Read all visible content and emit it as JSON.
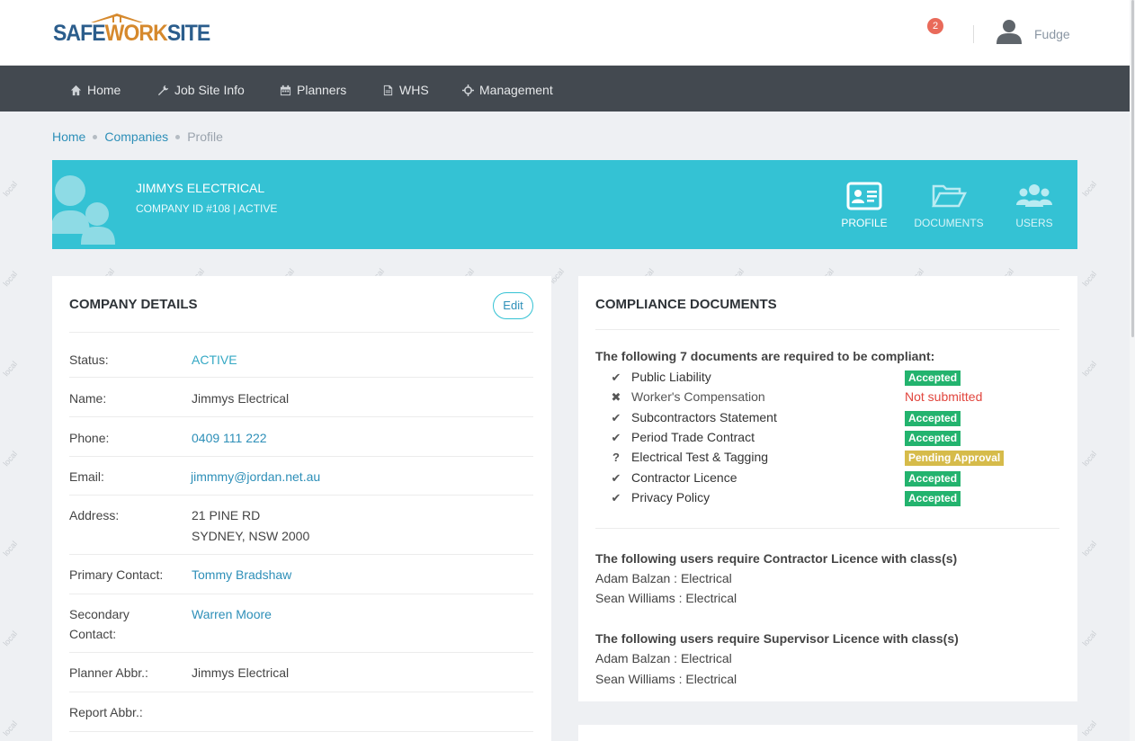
{
  "header": {
    "logo": {
      "safe": "SAFE",
      "work": "WORK",
      "site": "SITE"
    },
    "notification_count": "2",
    "user_name": "Fudge"
  },
  "nav": {
    "items": [
      {
        "label": "Home",
        "icon": "home-icon"
      },
      {
        "label": "Job Site Info",
        "icon": "wrench-icon"
      },
      {
        "label": "Planners",
        "icon": "calendar-icon"
      },
      {
        "label": "WHS",
        "icon": "document-icon"
      },
      {
        "label": "Management",
        "icon": "crosshair-icon"
      }
    ]
  },
  "breadcrumb": [
    "Home",
    "Companies",
    "Profile"
  ],
  "profile": {
    "company_name": "JIMMYS ELECTRICAL",
    "company_meta": "COMPANY ID #108  |  ACTIVE",
    "tabs": [
      {
        "label": "PROFILE",
        "icon": "id-card-icon",
        "active": true
      },
      {
        "label": "DOCUMENTS",
        "icon": "folder-open-icon",
        "active": false
      },
      {
        "label": "USERS",
        "icon": "users-icon",
        "active": false
      }
    ],
    "colors": {
      "banner": "#34c2d4",
      "accepted": "#23b36e",
      "pending": "#d6bb4a",
      "not_submitted": "#e1453d"
    }
  },
  "company_details": {
    "title": "COMPANY DETAILS",
    "edit_label": "Edit",
    "rows": [
      {
        "key": "Status:",
        "value": "ACTIVE"
      },
      {
        "key": "Name:",
        "value": "Jimmys Electrical"
      },
      {
        "key": "Phone:",
        "value": "0409 111 222"
      },
      {
        "key": "Email:",
        "value": "jimmmy@jordan.net.au"
      },
      {
        "key": "Address:",
        "value": "21 PINE RD",
        "value2": "SYDNEY, NSW 2000"
      },
      {
        "key": "Primary Contact:",
        "value": "Tommy Bradshaw"
      },
      {
        "key": "Secondary",
        "key2": "Contact:",
        "value": "Warren Moore"
      },
      {
        "key": "Planner Abbr.:",
        "value": "Jimmys Electrical"
      },
      {
        "key": "Report Abbr.:",
        "value": ""
      }
    ]
  },
  "compliance": {
    "title": "COMPLIANCE DOCUMENTS",
    "required_heading": "The following 7 documents are required to be compliant:",
    "documents": [
      {
        "mark": "✔",
        "name": "Public Liability",
        "status": "Accepted"
      },
      {
        "mark": "✖",
        "name": "Worker's Compensation",
        "status": "Not submitted"
      },
      {
        "mark": "✔",
        "name": "Subcontractors Statement",
        "status": "Accepted"
      },
      {
        "mark": "✔",
        "name": "Period Trade Contract",
        "status": "Accepted"
      },
      {
        "mark": "?",
        "name": "Electrical Test & Tagging",
        "status": "Pending Approval"
      },
      {
        "mark": "✔",
        "name": "Contractor Licence",
        "status": "Accepted"
      },
      {
        "mark": "✔",
        "name": "Privacy Policy",
        "status": "Accepted"
      }
    ],
    "contractor_heading": "The following users require Contractor Licence with class(s)",
    "contractor_users": [
      "Adam Balzan : Electrical",
      "Sean Williams : Electrical"
    ],
    "supervisor_heading": "The following users require Supervisor Licence with class(s)",
    "supervisor_users": [
      "Adam Balzan : Electrical",
      "Sean Williams : Electrical"
    ]
  },
  "watermark": "local"
}
